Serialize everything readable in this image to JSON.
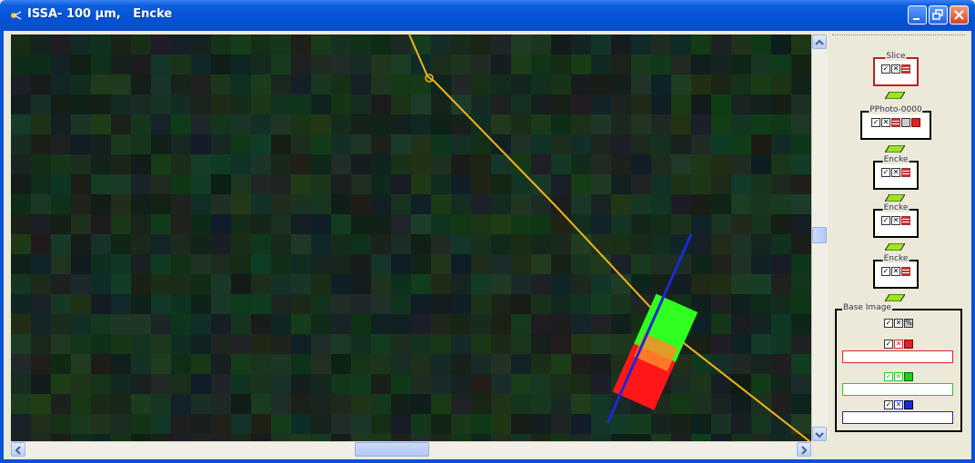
{
  "window": {
    "title": "ISSA- 100 µm,   Encke",
    "colors": {
      "titlebar": "#0552d5",
      "frame": "#0a52d4"
    }
  },
  "viewport": {
    "trajectory_color": "#f2b21a",
    "axis_color": "#1a2ad0",
    "particle_colors": [
      "#31ff1f",
      "#ff1616",
      "#ff8a2a"
    ]
  },
  "panel": {
    "layers": [
      {
        "name": "Slice",
        "icons": [
          "check-icon",
          "x-icon",
          "grid-icon"
        ]
      },
      {
        "name": "PPhoto-0000",
        "icons": [
          "check-icon",
          "x-icon",
          "grid-icon",
          "doc-icon",
          "stop-icon"
        ]
      },
      {
        "name": "Encke",
        "icons": [
          "check-icon",
          "x-icon",
          "grid-icon"
        ]
      },
      {
        "name": "Encke",
        "icons": [
          "check-icon",
          "x-icon",
          "grid-icon"
        ]
      },
      {
        "name": "Encke",
        "icons": [
          "check-icon",
          "x-icon",
          "grid-icon"
        ]
      }
    ],
    "base_image": {
      "label": "Base Image",
      "channels": [
        {
          "name": "red",
          "color": "#d22"
        },
        {
          "name": "green",
          "color": "#2c2"
        },
        {
          "name": "blue",
          "color": "#1a2ad0"
        }
      ]
    }
  }
}
